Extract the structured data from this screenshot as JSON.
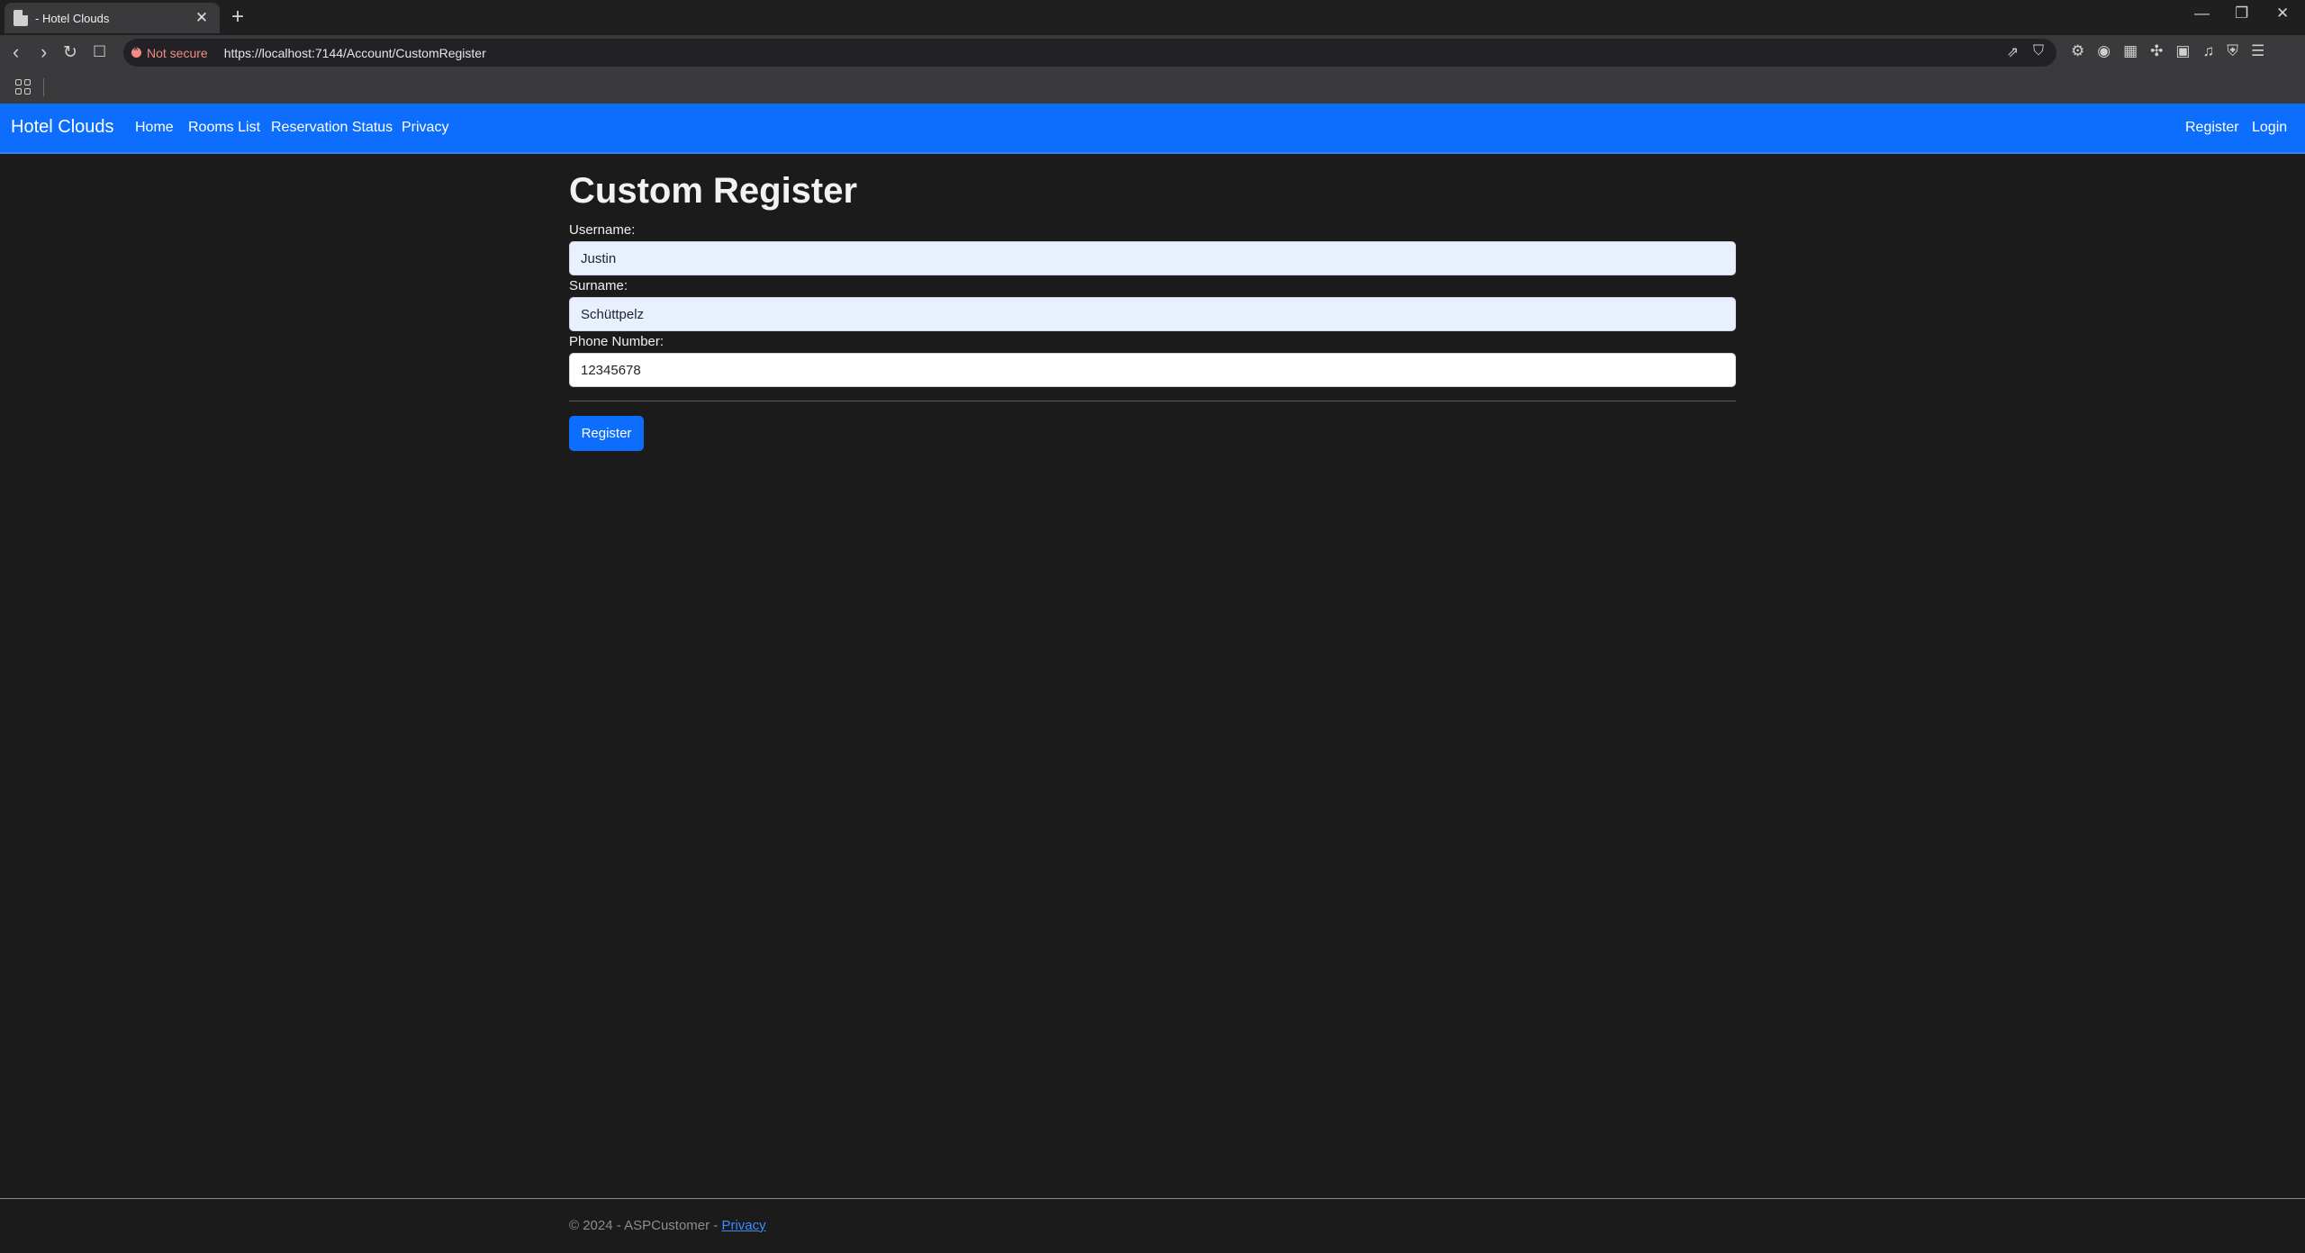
{
  "browser": {
    "tab_title": "- Hotel Clouds",
    "tab_close": "✕",
    "new_tab": "+",
    "window_controls": {
      "minimize": "—",
      "restore": "❐",
      "close": "✕"
    },
    "security_label": "Not secure",
    "url": "https://localhost:7144/Account/CustomRegister"
  },
  "navbar": {
    "brand": "Hotel Clouds",
    "links": [
      "Home",
      "Rooms List",
      "Reservation Status",
      "Privacy"
    ],
    "right_links": [
      "Register",
      "Login"
    ]
  },
  "form": {
    "title": "Custom Register",
    "username_label": "Username:",
    "username_value": "Justin",
    "surname_label": "Surname:",
    "surname_value": "Schüttpelz",
    "phone_label": "Phone Number:",
    "phone_value": "12345678",
    "submit_label": "Register"
  },
  "footer": {
    "text": "© 2024 - ASPCustomer - ",
    "link": "Privacy"
  }
}
